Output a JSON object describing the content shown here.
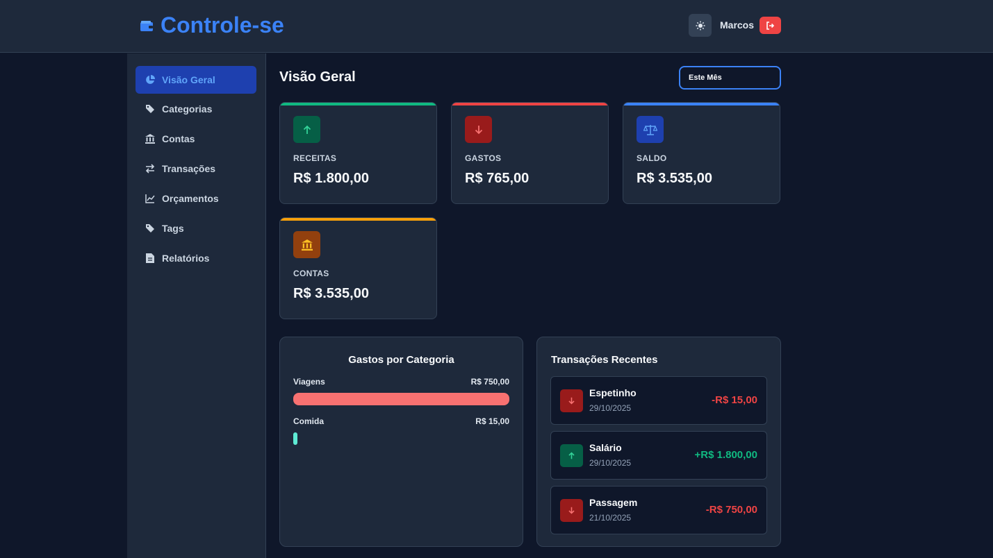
{
  "header": {
    "title": "Controle-se",
    "user_name": "Marcos",
    "brand_icon": "wallet-icon",
    "theme_icon": "sun-icon",
    "logout_icon": "logout-icon"
  },
  "sidebar": {
    "items": [
      {
        "label": "Visão Geral",
        "icon": "chart-pie-icon",
        "active": true
      },
      {
        "label": "Categorias",
        "icon": "tags-icon"
      },
      {
        "label": "Contas",
        "icon": "bank-icon"
      },
      {
        "label": "Transações",
        "icon": "exchange-icon"
      },
      {
        "label": "Orçamentos",
        "icon": "line-chart-icon"
      },
      {
        "label": "Tags",
        "icon": "tags-icon"
      },
      {
        "label": "Relatórios",
        "icon": "file-icon"
      }
    ]
  },
  "main": {
    "title": "Visão Geral",
    "period": "Este Mês",
    "stats": [
      {
        "label": "RECEITAS",
        "value": "R$ 1.800,00",
        "icon": "arrow-up-icon",
        "color": "#10b981",
        "icon_bg": "#065f46"
      },
      {
        "label": "GASTOS",
        "value": "R$ 765,00",
        "icon": "arrow-down-icon",
        "color": "#ef4444",
        "icon_bg": "#991b1b"
      },
      {
        "label": "SALDO",
        "value": "R$ 3.535,00",
        "icon": "balance-scale-icon",
        "color": "#3b82f6",
        "icon_bg": "#1e40af"
      },
      {
        "label": "CONTAS",
        "value": "R$ 3.535,00",
        "icon": "bank-icon",
        "color": "#f59e0b",
        "icon_bg": "#92400e"
      }
    ],
    "spending": {
      "title": "Gastos por Categoria",
      "items": [
        {
          "name": "Viagens",
          "amount": "R$ 750,00",
          "fraction": 1.0,
          "color": "#f87171"
        },
        {
          "name": "Comida",
          "amount": "R$ 15,00",
          "fraction": 0.02,
          "color": "#5eead4"
        }
      ]
    },
    "recent": {
      "title": "Transações Recentes",
      "items": [
        {
          "name": "Espetinho",
          "date": "29/10/2025",
          "amount": "-R$ 15,00",
          "type": "expense"
        },
        {
          "name": "Salário",
          "date": "29/10/2025",
          "amount": "+R$ 1.800,00",
          "type": "income"
        },
        {
          "name": "Passagem",
          "date": "21/10/2025",
          "amount": "-R$ 750,00",
          "type": "expense"
        }
      ]
    }
  },
  "colors": {
    "accent": "#3b82f6",
    "income": "#10b981",
    "expense": "#ef4444"
  }
}
